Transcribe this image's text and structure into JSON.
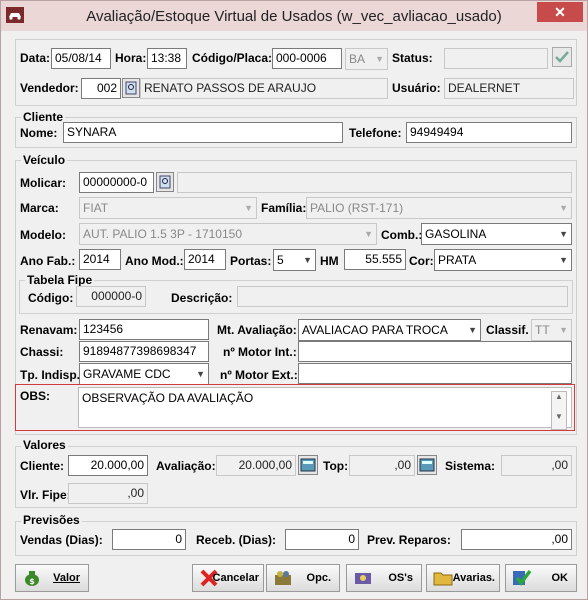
{
  "window": {
    "title": "Avaliação/Estoque Virtual de Usados (w_vec_avliacao_usado)",
    "close": "✕"
  },
  "header": {
    "data_label": "Data:",
    "data_value": "05/08/14",
    "hora_label": "Hora:",
    "hora_value": "13:38",
    "codigo_label": "Código/Placa:",
    "codigo_value": "000-0006",
    "uf_value": "BA",
    "status_label": "Status:",
    "status_value": "",
    "vendedor_label": "Vendedor:",
    "vendedor_code": "002",
    "vendedor_name": "RENATO PASSOS DE ARAUJO",
    "usuario_label": "Usuário:",
    "usuario_value": "DEALERNET"
  },
  "cliente": {
    "section": "Cliente",
    "nome_label": "Nome:",
    "nome_value": "SYNARA",
    "telefone_label": "Telefone:",
    "telefone_value": "94949494"
  },
  "veiculo": {
    "section": "Veículo",
    "molicar_label": "Molicar:",
    "molicar_value": "00000000-0",
    "molicar_desc": "",
    "marca_label": "Marca:",
    "marca_value": "FIAT",
    "familia_label": "Família:",
    "familia_value": "PALIO (RST-171)",
    "modelo_label": "Modelo:",
    "modelo_value": "AUT. PALIO 1.5 3P - 1710150",
    "comb_label": "Comb.:",
    "comb_value": "GASOLINA",
    "anofab_label": "Ano Fab.:",
    "anofab_value": "2014",
    "anomod_label": "Ano Mod.:",
    "anomod_value": "2014",
    "portas_label": "Portas:",
    "portas_value": "5",
    "hm_label": "HM",
    "hm_value": "55.555",
    "cor_label": "Cor:",
    "cor_value": "PRATA",
    "fipe_section": "Tabela Fipe",
    "fipe_codigo_label": "Código:",
    "fipe_codigo_value": "000000-0",
    "fipe_desc_label": "Descrição:",
    "fipe_desc_value": "",
    "renavam_label": "Renavam:",
    "renavam_value": "123456",
    "mtaval_label": "Mt. Avaliação:",
    "mtaval_value": "AVALIACAO PARA TROCA",
    "classif_label": "Classif.",
    "classif_value": "TT",
    "chassi_label": "Chassi:",
    "chassi_value": "91894877398698347",
    "motorint_label": "nº Motor Int.:",
    "motorint_value": "",
    "tpindisp_label": "Tp. Indisp.:",
    "tpindisp_value": "GRAVAME CDC",
    "motorext_label": "nº Motor Ext.:",
    "motorext_value": ""
  },
  "obs": {
    "label": "OBS:",
    "value": "OBSERVAÇÃO DA AVALIAÇÃO",
    "up": "▲",
    "down": "▼"
  },
  "valores": {
    "section": "Valores",
    "cliente_label": "Cliente:",
    "cliente_value": "20.000,00",
    "avaliacao_label": "Avaliação:",
    "avaliacao_value": "20.000,00",
    "top_label": "Top:",
    "top_value": ",00",
    "sistema_label": "Sistema:",
    "sistema_value": ",00",
    "fipe_label": "Vlr. Fipe:",
    "fipe_value": ",00"
  },
  "previsoes": {
    "section": "Previsões",
    "vendas_label": "Vendas (Dias):",
    "vendas_value": "0",
    "receb_label": "Receb. (Dias):",
    "receb_value": "0",
    "reparos_label": "Prev. Reparos:",
    "reparos_value": ",00"
  },
  "buttons": {
    "valor": "Valor",
    "cancelar": "Cancelar",
    "opc": "Opc.",
    "oss": "OS's",
    "avarias": "Avarias.",
    "ok": "OK"
  },
  "colors": {
    "title_bar": "#ead7d6",
    "close": "#c74b4b",
    "obs_border": "#d23c3c"
  }
}
